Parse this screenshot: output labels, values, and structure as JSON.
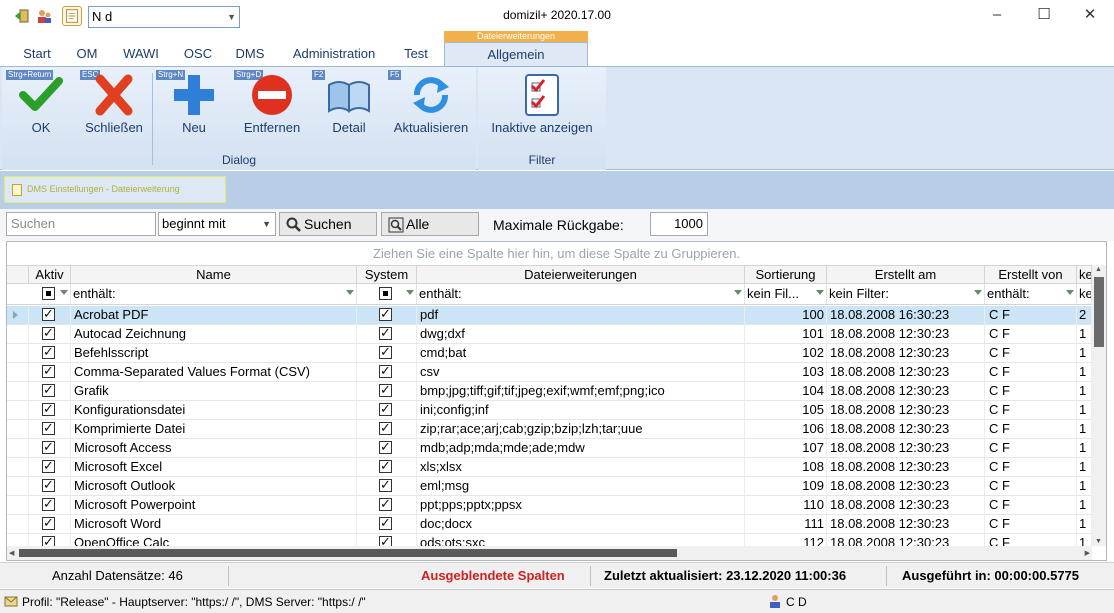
{
  "titlebar": {
    "title": "domizil+ 2020.17.00",
    "user_combo": "N                 d"
  },
  "ribbon": {
    "context_header": "Dateierweiterungen",
    "tabs": [
      "Start",
      "OM",
      "WAWI",
      "OSC",
      "DMS",
      "Administration",
      "Test",
      "Allgemein"
    ],
    "active_tab": "Allgemein",
    "buttons": [
      {
        "label": "OK",
        "key": "Strg+Return"
      },
      {
        "label": "Schließen",
        "key": "ESC"
      },
      {
        "label": "Neu",
        "key": "Strg+N"
      },
      {
        "label": "Entfernen",
        "key": "Strg+D"
      },
      {
        "label": "Detail",
        "key": "F2"
      },
      {
        "label": "Aktualisieren",
        "key": "F5"
      },
      {
        "label": "Inaktive anzeigen",
        "key": ""
      }
    ],
    "groups": [
      "Dialog",
      "Filter"
    ]
  },
  "doc_tab": "DMS Einstellungen - Dateierweiterung",
  "search": {
    "placeholder": "Suchen",
    "mode": "beginnt mit",
    "search_button": "Suchen",
    "all_button": "Alle",
    "max_label": "Maximale Rückgabe:",
    "max_value": "1000"
  },
  "grid": {
    "group_hint": "Ziehen Sie eine Spalte hier hin, um diese Spalte zu Gruppieren.",
    "columns": [
      "Aktiv",
      "Name",
      "System",
      "Dateierweiterungen",
      "Sortierung",
      "Erstellt am",
      "Erstellt von",
      "ke"
    ],
    "filters": {
      "name": "enthält:",
      "ext": "enthält:",
      "sort": "kein  Fil...",
      "created": "kein Filter:",
      "by": "enthält:",
      "last": "ke"
    },
    "rows": [
      {
        "name": "Acrobat PDF",
        "ext": "pdf",
        "sort": "100",
        "created": "18.08.2008 16:30:23",
        "by": "C         F",
        "last": "2"
      },
      {
        "name": "Autocad Zeichnung",
        "ext": "dwg;dxf",
        "sort": "101",
        "created": "18.08.2008 12:30:23",
        "by": "C         F",
        "last": "1"
      },
      {
        "name": "Befehlsscript",
        "ext": "cmd;bat",
        "sort": "102",
        "created": "18.08.2008 12:30:23",
        "by": "C         F",
        "last": "1"
      },
      {
        "name": "Comma-Separated Values Format (CSV)",
        "ext": "csv",
        "sort": "103",
        "created": "18.08.2008 12:30:23",
        "by": "C         F",
        "last": "1"
      },
      {
        "name": "Grafik",
        "ext": "bmp;jpg;tiff;gif;tif;jpeg;exif;wmf;emf;png;ico",
        "sort": "104",
        "created": "18.08.2008 12:30:23",
        "by": "C         F",
        "last": "1"
      },
      {
        "name": "Konfigurationsdatei",
        "ext": "ini;config;inf",
        "sort": "105",
        "created": "18.08.2008 12:30:23",
        "by": "C         F",
        "last": "1"
      },
      {
        "name": "Komprimierte Datei",
        "ext": "zip;rar;ace;arj;cab;gzip;bzip;lzh;tar;uue",
        "sort": "106",
        "created": "18.08.2008 12:30:23",
        "by": "C         F",
        "last": "1"
      },
      {
        "name": "Microsoft Access",
        "ext": "mdb;adp;mda;mde;ade;mdw",
        "sort": "107",
        "created": "18.08.2008 12:30:23",
        "by": "C         F",
        "last": "1"
      },
      {
        "name": "Microsoft Excel",
        "ext": "xls;xlsx",
        "sort": "108",
        "created": "18.08.2008 12:30:23",
        "by": "C         F",
        "last": "1"
      },
      {
        "name": "Microsoft Outlook",
        "ext": "eml;msg",
        "sort": "109",
        "created": "18.08.2008 12:30:23",
        "by": "C         F",
        "last": "1"
      },
      {
        "name": "Microsoft Powerpoint",
        "ext": "ppt;pps;pptx;ppsx",
        "sort": "110",
        "created": "18.08.2008 12:30:23",
        "by": "C         F",
        "last": "1"
      },
      {
        "name": "Microsoft Word",
        "ext": "doc;docx",
        "sort": "111",
        "created": "18.08.2008 12:30:23",
        "by": "C         F",
        "last": "1"
      },
      {
        "name": "OpenOffice Calc",
        "ext": "ods;ots;sxc",
        "sort": "112",
        "created": "18.08.2008 12:30:23",
        "by": "C         F",
        "last": "1"
      }
    ]
  },
  "status": {
    "count": "Anzahl Datensätze: 46",
    "hidden": "Ausgeblendete Spalten",
    "updated": "Zuletzt aktualisiert: 23.12.2020 11:00:36",
    "exec": "Ausgeführt in: 00:00:00.5775",
    "profile": "Profil: \"Release\" - Hauptserver: \"https:/                              /\", DMS Server: \"https:/                              /\"",
    "user": "C          D"
  },
  "colors": {
    "accent": "#1d3c6a",
    "context_tab": "#f0b04a",
    "hidden_cols": "#d02020",
    "selected_row": "#cbe4f6"
  }
}
